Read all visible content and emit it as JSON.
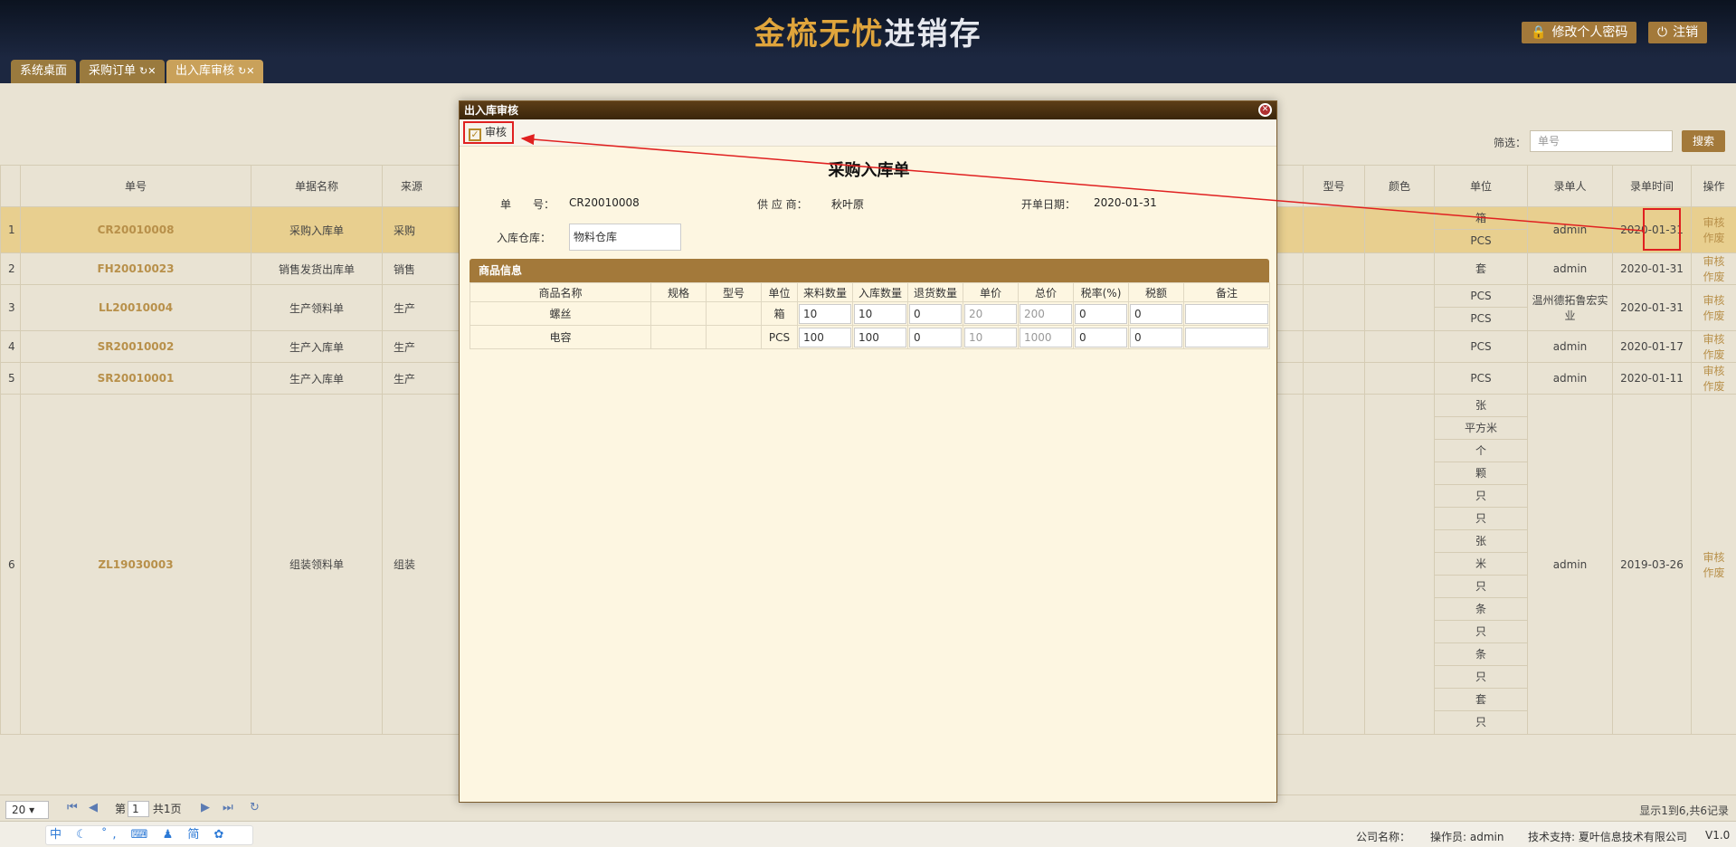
{
  "header": {
    "logo_part1": "金梳无忧",
    "logo_part2": "进销存",
    "change_password_label": "修改个人密码",
    "logout_label": "注销"
  },
  "tabs": [
    {
      "label": "系统桌面"
    },
    {
      "label": "采购订单"
    },
    {
      "label": "出入库审核"
    }
  ],
  "filter": {
    "label": "筛选：",
    "placeholder": "单号",
    "search_label": "搜索"
  },
  "grid": {
    "columns": [
      "单号",
      "单据名称",
      "来源",
      "型号",
      "颜色",
      "单位",
      "录单人",
      "录单时间",
      "操作"
    ],
    "rows": [
      {
        "index": "1",
        "code": "CR20010008",
        "name": "采购入库单",
        "source": "采购",
        "units": [
          "箱",
          "PCS"
        ],
        "user": "admin",
        "date": "2020-01-31",
        "op1": "审核",
        "op2": "作废"
      },
      {
        "index": "2",
        "code": "FH20010023",
        "name": "销售发货出库单",
        "source": "销售",
        "units": [
          "套"
        ],
        "user": "admin",
        "date": "2020-01-31",
        "op1": "审核",
        "op2": "作废"
      },
      {
        "index": "3",
        "code": "LL20010004",
        "name": "生产领料单",
        "source": "生产",
        "units": [
          "PCS",
          "PCS"
        ],
        "user": "温州德拓鲁宏实业",
        "date": "2020-01-31",
        "op1": "审核",
        "op2": "作废"
      },
      {
        "index": "4",
        "code": "SR20010002",
        "name": "生产入库单",
        "source": "生产",
        "units": [
          "PCS"
        ],
        "user": "admin",
        "date": "2020-01-17",
        "op1": "审核",
        "op2": "作废"
      },
      {
        "index": "5",
        "code": "SR20010001",
        "name": "生产入库单",
        "source": "生产",
        "units": [
          "PCS"
        ],
        "user": "admin",
        "date": "2020-01-11",
        "op1": "审核",
        "op2": "作废"
      },
      {
        "index": "6",
        "code": "ZL19030003",
        "name": "组装领料单",
        "source": "组装",
        "units": [
          "张",
          "平方米",
          "个",
          "颗",
          "只",
          "只",
          "张",
          "米",
          "只",
          "条",
          "只",
          "条",
          "只",
          "套",
          "只"
        ],
        "user": "admin",
        "date": "2019-03-26",
        "op1": "审核",
        "op2": "作废"
      }
    ]
  },
  "pager": {
    "page_size": "20",
    "page_prefix": "第",
    "page_value": "1",
    "page_total": "共1页",
    "info": "显示1到6,共6记录"
  },
  "footer": {
    "ime_label": "中 ☾ ˚, ⌨ ♟ 简 ✿ ⚙",
    "company": "公司名称：",
    "operator": "操作员: admin",
    "support": "技术支持: 夏叶信息技术有限公司",
    "version": "V1.0"
  },
  "dialog": {
    "title": "出入库审核",
    "audit_label": "审核",
    "heading": "采购入库单",
    "order_no_label": "单　　号：",
    "order_no": "CR20010008",
    "supplier_label": "供 应 商：",
    "supplier": "秋叶原",
    "date_label": "开单日期：",
    "date": "2020-01-31",
    "warehouse_label": "入库仓库：",
    "warehouse": "物料仓库",
    "goods_title": "商品信息",
    "goods_columns": [
      "商品名称",
      "规格",
      "型号",
      "单位",
      "来料数量",
      "入库数量",
      "退货数量",
      "单价",
      "总价",
      "税率(%)",
      "税额",
      "备注"
    ],
    "goods_rows": [
      {
        "name": "螺丝",
        "spec": "",
        "model": "",
        "unit": "箱",
        "in_qty": "10",
        "stock_qty": "10",
        "return_qty": "0",
        "price": "20",
        "total": "200",
        "tax_rate": "0",
        "tax": "0",
        "note": ""
      },
      {
        "name": "电容",
        "spec": "",
        "model": "",
        "unit": "PCS",
        "in_qty": "100",
        "stock_qty": "100",
        "return_qty": "0",
        "price": "10",
        "total": "1000",
        "tax_rate": "0",
        "tax": "0",
        "note": ""
      }
    ]
  },
  "colors": {
    "accent": "#a3793a",
    "header_bg": "#0c1320",
    "highlight": "#e02020"
  }
}
